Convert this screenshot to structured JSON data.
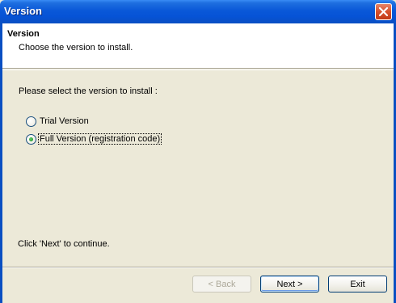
{
  "window": {
    "title": "Version"
  },
  "header": {
    "title": "Version",
    "subtitle": "Choose the version to install."
  },
  "content": {
    "prompt": "Please select the version to install :",
    "options": [
      {
        "label": "Trial Version",
        "selected": false
      },
      {
        "label": "Full Version (registration code)",
        "selected": true
      }
    ],
    "continue_hint": "Click 'Next' to continue."
  },
  "buttons": {
    "back": "< Back",
    "next": "Next >",
    "exit": "Exit"
  },
  "colors": {
    "titlebar": "#0a58d8",
    "dialog_bg": "#ece9d8",
    "header_bg": "#ffffff",
    "close": "#d6502c"
  },
  "icons": {
    "close": "close-icon"
  }
}
